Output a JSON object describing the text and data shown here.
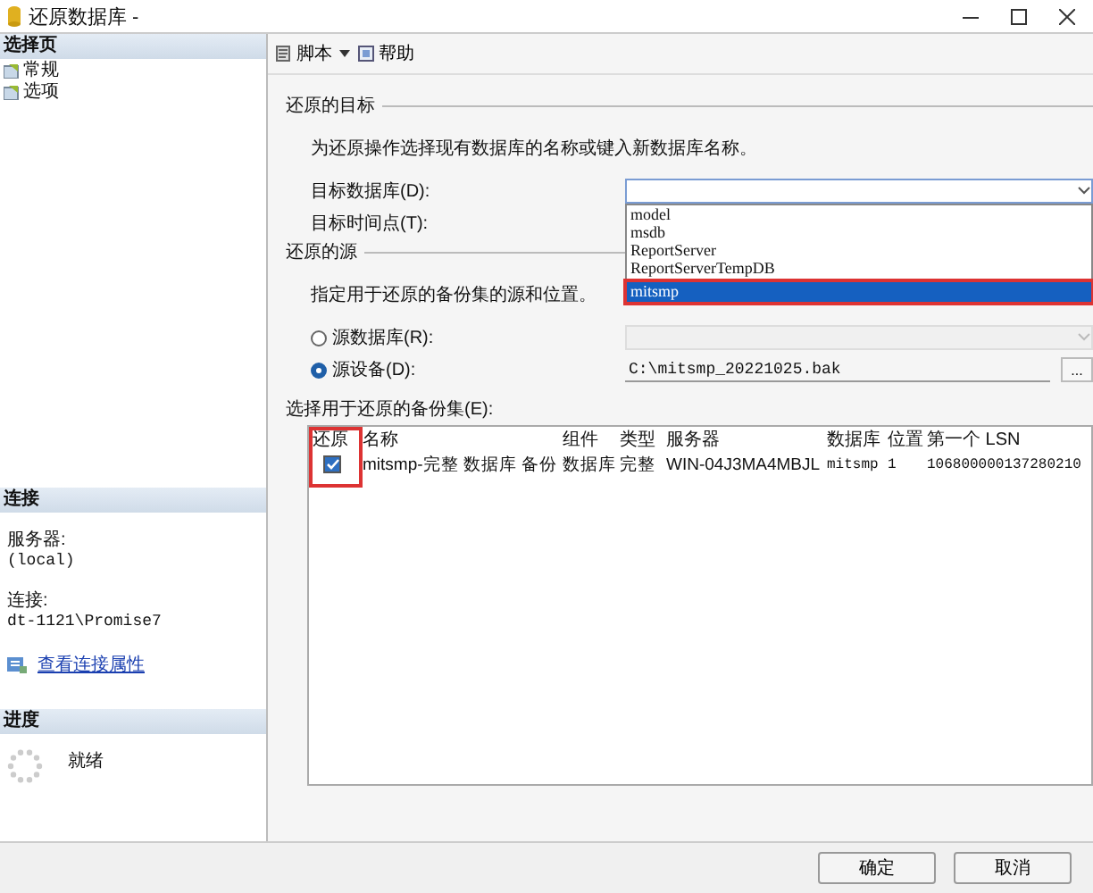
{
  "window": {
    "title": "还原数据库 -"
  },
  "sidebar": {
    "header": "选择页",
    "items": [
      {
        "label": "常规"
      },
      {
        "label": "选项"
      }
    ]
  },
  "connection": {
    "header": "连接",
    "server_label": "服务器:",
    "server": "(local)",
    "connection_label": "连接:",
    "connection": "dt-1121\\Promise7",
    "link": "查看连接属性"
  },
  "progress": {
    "header": "进度",
    "status": "就绪"
  },
  "toolbar": [
    {
      "label": "脚本",
      "kind": "dropdown"
    },
    {
      "label": "帮助",
      "kind": "button"
    }
  ],
  "destination": {
    "header": "还原的目标",
    "description": "为还原操作选择现有数据库的名称或键入新数据库名称。",
    "database_label": "目标数据库(D):",
    "time_label": "目标时间点(T):",
    "dropdown": [
      {
        "label": "model",
        "selected": false,
        "annotated": false
      },
      {
        "label": "msdb",
        "selected": false,
        "annotated": false
      },
      {
        "label": "ReportServer",
        "selected": false,
        "annotated": false
      },
      {
        "label": "ReportServerTempDB",
        "selected": false,
        "annotated": false
      },
      {
        "label": "mitsmp",
        "selected": true,
        "annotated": true
      }
    ]
  },
  "source": {
    "header": "还原的源",
    "description": "指定用于还原的备份集的源和位置。",
    "options": [
      {
        "label": "源数据库(R):",
        "selected": false,
        "kind": "dropdown"
      },
      {
        "label": "源设备(D):",
        "selected": true,
        "kind": "file",
        "value": "C:\\mitsmp_20221025.bak",
        "browse": "..."
      }
    ],
    "backup_sets_label": "选择用于还原的备份集(E):"
  },
  "backup_sets": {
    "restore_column_annotated": true,
    "columns": [
      "还原",
      "名称",
      "组件",
      "类型",
      "服务器",
      "数据库",
      "位置",
      "第一个 LSN"
    ],
    "rows": [
      {
        "restore": true,
        "cells": [
          "",
          "mitsmp-完整 数据库 备份",
          "数据库",
          "完整",
          "WIN-04J3MA4MBJL",
          "mitsmp",
          "1",
          "106800000137280210"
        ]
      }
    ]
  },
  "buttons": [
    "确定",
    "取消"
  ]
}
